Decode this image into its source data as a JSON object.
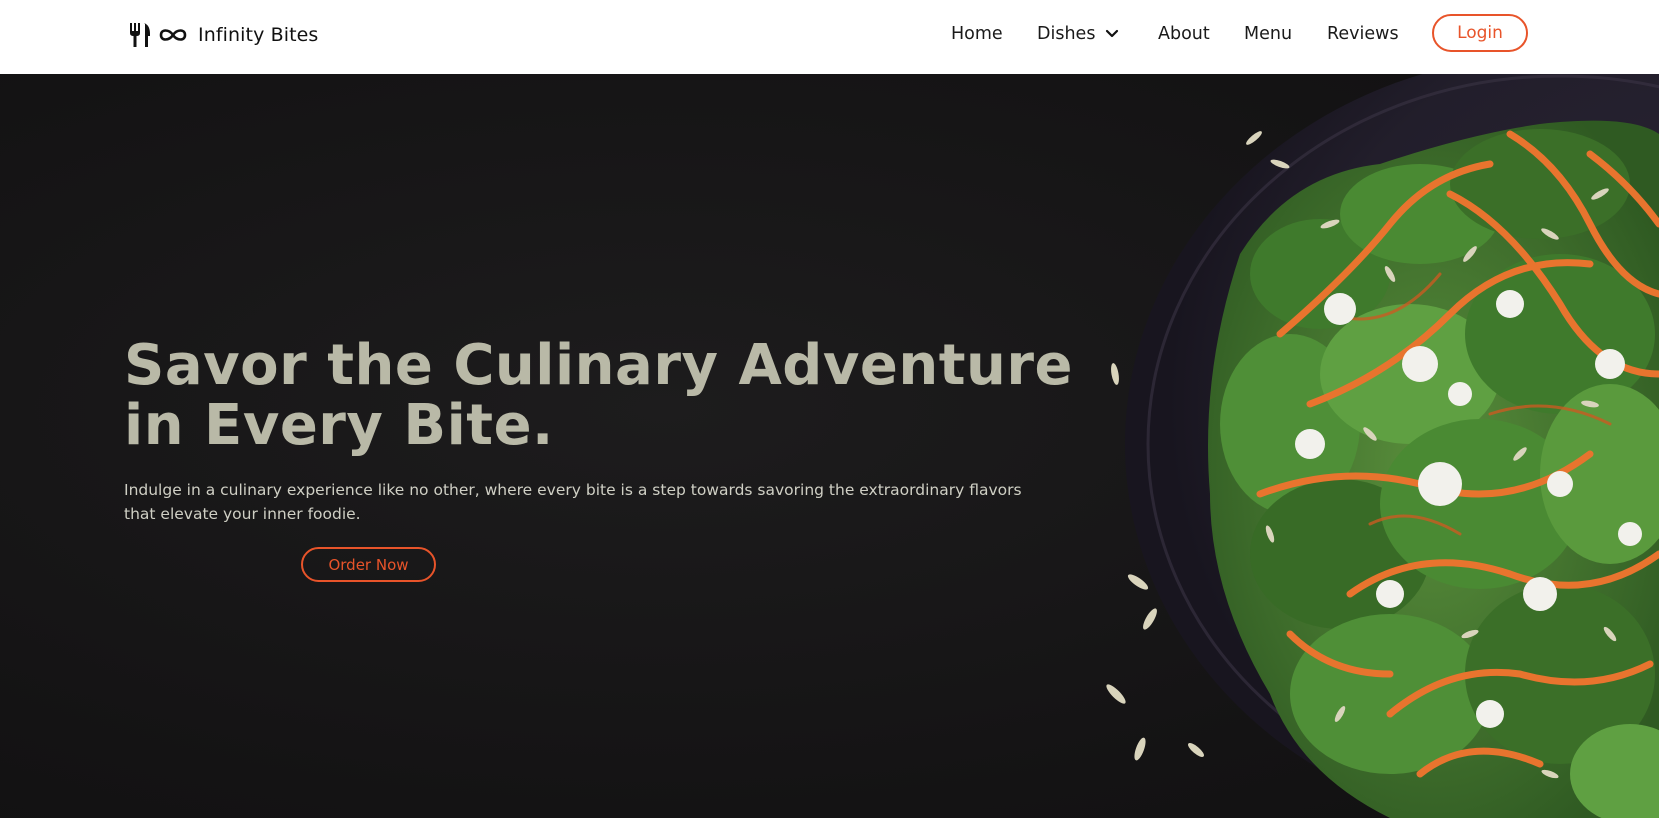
{
  "brand": {
    "name": "Infinity Bites",
    "logo_icon": "fork-knife-infinity-icon"
  },
  "nav": {
    "items": [
      {
        "label": "Home"
      },
      {
        "label": "Dishes",
        "icon": "chevron-down-icon"
      },
      {
        "label": "About"
      },
      {
        "label": "Menu"
      },
      {
        "label": "Reviews"
      }
    ],
    "login_label": "Login"
  },
  "hero": {
    "title_line1": "Savor the Culinary Adventure",
    "title_line2": "in Every Bite.",
    "subtitle_line1": "Indulge in a culinary experience like no other, where every bite is a step towards savoring the extraordinary flavors",
    "subtitle_line2": "that elevate your inner foodie.",
    "cta_label": "Order Now",
    "image": "salad-bowl-image"
  },
  "colors": {
    "accent": "#e8542a",
    "hero_bg": "#161516",
    "title_text": "#b9b9a7",
    "nav_bg": "#ffffff"
  }
}
